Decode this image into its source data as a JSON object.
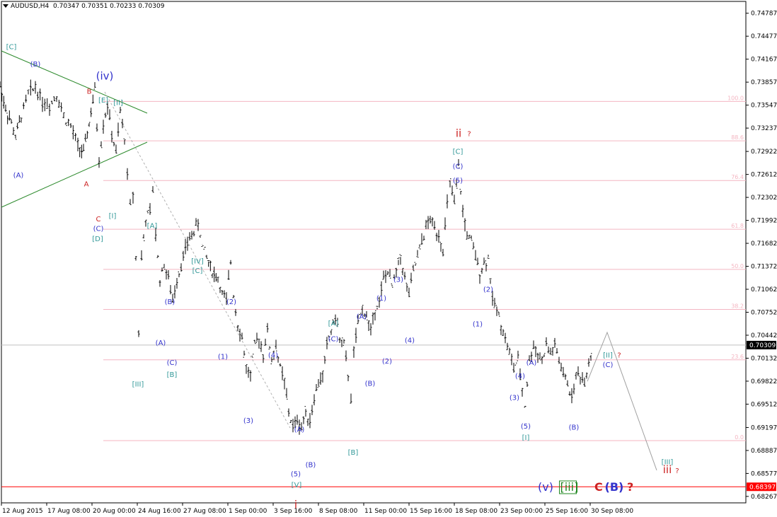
{
  "header": {
    "symbol_timeframe": "AUDUSD,H4",
    "ohlc": "0.70347 0.70351 0.70233 0.70309"
  },
  "colors": {
    "background": "#ffffff",
    "candle": "#000000",
    "fib_line": "#f4b6c2",
    "fib_label": "#f4b6c2",
    "trendline": "#2e8b2e",
    "support_line": "#ff0000",
    "price_line": "#c0c0c0",
    "label_blue": "#3333cc",
    "label_teal": "#339999",
    "label_red": "#cc2222",
    "label_green": "#228822",
    "projection": "#a0a0a0",
    "dashed": "#b0b0b0"
  },
  "chart_data": {
    "type": "candlestick",
    "title": "AUDUSD,H4",
    "y_axis": {
      "ylim": [
        0.6818,
        0.7487
      ],
      "ticks": [
        "0.74787",
        "0.74477",
        "0.74167",
        "0.73857",
        "0.73547",
        "0.73237",
        "0.72922",
        "0.72612",
        "0.72302",
        "0.71992",
        "0.71682",
        "0.71372",
        "0.71062",
        "0.70752",
        "0.70442",
        "0.70132",
        "0.69822",
        "0.69512",
        "0.69197",
        "0.68887",
        "0.68577",
        "0.68267"
      ],
      "current_price": "0.70309",
      "support_price": "0.68397"
    },
    "x_axis": {
      "tick_labels": [
        "12 Aug 2015",
        "17 Aug 08:00",
        "20 Aug 00:00",
        "24 Aug 16:00",
        "27 Aug 08:00",
        "1 Sep 00:00",
        "3 Sep 16:00",
        "8 Sep 08:00",
        "11 Sep 00:00",
        "15 Sep 16:00",
        "18 Sep 08:00",
        "23 Sep 00:00",
        "25 Sep 16:00",
        "30 Sep 08:00"
      ]
    },
    "fib_levels": [
      {
        "label": "100.0",
        "value": 0.73597
      },
      {
        "label": "88.6",
        "value": 0.73065
      },
      {
        "label": "76.4",
        "value": 0.7253
      },
      {
        "label": "61.8",
        "value": 0.71872
      },
      {
        "label": "50.0",
        "value": 0.7133
      },
      {
        "label": "38.2",
        "value": 0.7079
      },
      {
        "label": "23.6",
        "value": 0.7011
      },
      {
        "label": "0.0",
        "value": 0.6902
      }
    ],
    "price_path": [
      [
        0,
        0.738
      ],
      [
        8,
        0.735
      ],
      [
        16,
        0.733
      ],
      [
        22,
        0.7312
      ],
      [
        30,
        0.734
      ],
      [
        40,
        0.737
      ],
      [
        50,
        0.738
      ],
      [
        60,
        0.736
      ],
      [
        70,
        0.7355
      ],
      [
        80,
        0.737
      ],
      [
        90,
        0.734
      ],
      [
        100,
        0.7325
      ],
      [
        110,
        0.73
      ],
      [
        118,
        0.729
      ],
      [
        126,
        0.733
      ],
      [
        134,
        0.7375
      ],
      [
        140,
        0.728
      ],
      [
        146,
        0.733
      ],
      [
        152,
        0.7355
      ],
      [
        158,
        0.7315
      ],
      [
        164,
        0.729
      ],
      [
        170,
        0.7345
      ],
      [
        176,
        0.731
      ],
      [
        180,
        0.726
      ],
      [
        184,
        0.722
      ],
      [
        188,
        0.7235
      ],
      [
        192,
        0.715
      ],
      [
        196,
        0.705
      ],
      [
        200,
        0.715
      ],
      [
        206,
        0.72
      ],
      [
        212,
        0.721
      ],
      [
        216,
        0.724
      ],
      [
        220,
        0.718
      ],
      [
        226,
        0.712
      ],
      [
        232,
        0.714
      ],
      [
        238,
        0.712
      ],
      [
        244,
        0.709
      ],
      [
        250,
        0.712
      ],
      [
        256,
        0.714
      ],
      [
        262,
        0.716
      ],
      [
        268,
        0.7175
      ],
      [
        274,
        0.7185
      ],
      [
        280,
        0.7195
      ],
      [
        286,
        0.7165
      ],
      [
        292,
        0.715
      ],
      [
        300,
        0.713
      ],
      [
        308,
        0.712
      ],
      [
        314,
        0.71
      ],
      [
        320,
        0.709
      ],
      [
        326,
        0.7145
      ],
      [
        330,
        0.71
      ],
      [
        336,
        0.706
      ],
      [
        342,
        0.704
      ],
      [
        348,
        0.7
      ],
      [
        354,
        0.699
      ],
      [
        360,
        0.703
      ],
      [
        366,
        0.704
      ],
      [
        372,
        0.702
      ],
      [
        378,
        0.705
      ],
      [
        384,
        0.701
      ],
      [
        390,
        0.703
      ],
      [
        396,
        0.7
      ],
      [
        402,
        0.698
      ],
      [
        408,
        0.694
      ],
      [
        414,
        0.692
      ],
      [
        420,
        0.693
      ],
      [
        426,
        0.692
      ],
      [
        432,
        0.694
      ],
      [
        438,
        0.693
      ],
      [
        444,
        0.696
      ],
      [
        450,
        0.698
      ],
      [
        456,
        0.699
      ],
      [
        462,
        0.703
      ],
      [
        468,
        0.705
      ],
      [
        474,
        0.707
      ],
      [
        480,
        0.704
      ],
      [
        486,
        0.703
      ],
      [
        492,
        0.699
      ],
      [
        496,
        0.696
      ],
      [
        500,
        0.702
      ],
      [
        506,
        0.706
      ],
      [
        512,
        0.708
      ],
      [
        518,
        0.707
      ],
      [
        524,
        0.705
      ],
      [
        530,
        0.708
      ],
      [
        536,
        0.709
      ],
      [
        542,
        0.712
      ],
      [
        548,
        0.713
      ],
      [
        554,
        0.711
      ],
      [
        560,
        0.713
      ],
      [
        566,
        0.715
      ],
      [
        572,
        0.712
      ],
      [
        578,
        0.71
      ],
      [
        584,
        0.713
      ],
      [
        590,
        0.715
      ],
      [
        596,
        0.717
      ],
      [
        602,
        0.719
      ],
      [
        608,
        0.72
      ],
      [
        614,
        0.719
      ],
      [
        620,
        0.718
      ],
      [
        626,
        0.716
      ],
      [
        632,
        0.722
      ],
      [
        636,
        0.725
      ],
      [
        642,
        0.722
      ],
      [
        648,
        0.727
      ],
      [
        654,
        0.721
      ],
      [
        660,
        0.718
      ],
      [
        666,
        0.717
      ],
      [
        672,
        0.715
      ],
      [
        678,
        0.713
      ],
      [
        684,
        0.714
      ],
      [
        690,
        0.715
      ],
      [
        696,
        0.709
      ],
      [
        702,
        0.708
      ],
      [
        708,
        0.706
      ],
      [
        714,
        0.704
      ],
      [
        720,
        0.702
      ],
      [
        726,
        0.7
      ],
      [
        732,
        0.701
      ],
      [
        738,
        0.697
      ],
      [
        742,
        0.695
      ],
      [
        748,
        0.701
      ],
      [
        754,
        0.703
      ],
      [
        760,
        0.702
      ],
      [
        766,
        0.701
      ],
      [
        772,
        0.703
      ],
      [
        778,
        0.702
      ],
      [
        784,
        0.703
      ],
      [
        790,
        0.701
      ],
      [
        796,
        0.699
      ],
      [
        802,
        0.698
      ],
      [
        808,
        0.696
      ],
      [
        814,
        0.699
      ],
      [
        820,
        0.699
      ],
      [
        826,
        0.698
      ],
      [
        832,
        0.701
      ],
      [
        838,
        0.703
      ]
    ],
    "projection": [
      [
        830,
        0.6982
      ],
      [
        858,
        0.7048
      ],
      [
        928,
        0.6862
      ]
    ],
    "wave_labels": [
      {
        "text": "[C]",
        "x": 16,
        "v": 0.743,
        "color": "teal"
      },
      {
        "text": "(B)",
        "x": 50,
        "v": 0.7407,
        "color": "blue"
      },
      {
        "text": "(A)",
        "x": 26,
        "v": 0.7257,
        "color": "blue"
      },
      {
        "text": "B",
        "x": 126,
        "v": 0.737,
        "color": "red"
      },
      {
        "text": "(iv)",
        "x": 148,
        "v": 0.7389,
        "color": "blue",
        "big": true
      },
      {
        "text": "[E]",
        "x": 146,
        "v": 0.7358,
        "color": "teal"
      },
      {
        "text": "[II]",
        "x": 167,
        "v": 0.7355,
        "color": "teal"
      },
      {
        "text": "A",
        "x": 122,
        "v": 0.7245,
        "color": "red"
      },
      {
        "text": "[I]",
        "x": 159,
        "v": 0.7202,
        "color": "teal"
      },
      {
        "text": "C",
        "x": 139,
        "v": 0.7198,
        "color": "red"
      },
      {
        "text": "(C)",
        "x": 139,
        "v": 0.7185,
        "color": "blue"
      },
      {
        "text": "[D]",
        "x": 138,
        "v": 0.7171,
        "color": "teal"
      },
      {
        "text": "[A]",
        "x": 215,
        "v": 0.7189,
        "color": "teal"
      },
      {
        "text": "[IV]",
        "x": 279,
        "v": 0.7141,
        "color": "teal"
      },
      {
        "text": "[C]",
        "x": 279,
        "v": 0.7128,
        "color": "teal"
      },
      {
        "text": "(B)",
        "x": 240,
        "v": 0.7086,
        "color": "blue"
      },
      {
        "text": "(2)",
        "x": 327,
        "v": 0.7086,
        "color": "blue"
      },
      {
        "text": "(A)",
        "x": 227,
        "v": 0.7031,
        "color": "blue"
      },
      {
        "text": "(C)",
        "x": 243,
        "v": 0.7004,
        "color": "blue"
      },
      {
        "text": "[B]",
        "x": 243,
        "v": 0.6988,
        "color": "teal"
      },
      {
        "text": "(1)",
        "x": 315,
        "v": 0.7012,
        "color": "blue"
      },
      {
        "text": "(4)",
        "x": 386,
        "v": 0.7014,
        "color": "blue"
      },
      {
        "text": "[III]",
        "x": 195,
        "v": 0.6975,
        "color": "teal"
      },
      {
        "text": "(3)",
        "x": 351,
        "v": 0.6926,
        "color": "blue"
      },
      {
        "text": "(A)",
        "x": 423,
        "v": 0.6914,
        "color": "blue"
      },
      {
        "text": "(B)",
        "x": 439,
        "v": 0.6866,
        "color": "blue"
      },
      {
        "text": "(5)",
        "x": 418,
        "v": 0.6854,
        "color": "blue"
      },
      {
        "text": "[V]",
        "x": 419,
        "v": 0.6839,
        "color": "teal"
      },
      {
        "text": "i",
        "x": 418,
        "v": 0.6811,
        "color": "red",
        "big": true
      },
      {
        "text": "[A]",
        "x": 471,
        "v": 0.7057,
        "color": "teal"
      },
      {
        "text": "(A)",
        "x": 511,
        "v": 0.7066,
        "color": "blue"
      },
      {
        "text": "(C)",
        "x": 471,
        "v": 0.7036,
        "color": "blue"
      },
      {
        "text": "(1)",
        "x": 539,
        "v": 0.7091,
        "color": "blue"
      },
      {
        "text": "(3)",
        "x": 563,
        "v": 0.7116,
        "color": "blue"
      },
      {
        "text": "(4)",
        "x": 579,
        "v": 0.7034,
        "color": "blue"
      },
      {
        "text": "(2)",
        "x": 547,
        "v": 0.7006,
        "color": "blue"
      },
      {
        "text": "(B)",
        "x": 523,
        "v": 0.6976,
        "color": "blue"
      },
      {
        "text": "[B]",
        "x": 499,
        "v": 0.6883,
        "color": "teal"
      },
      {
        "text": "ii",
        "x": 648,
        "v": 0.7312,
        "color": "red",
        "big": true
      },
      {
        "text": "?",
        "x": 663,
        "v": 0.7313,
        "color": "red"
      },
      {
        "text": "[C]",
        "x": 647,
        "v": 0.7289,
        "color": "teal"
      },
      {
        "text": "(C)",
        "x": 647,
        "v": 0.7269,
        "color": "blue"
      },
      {
        "text": "(5)",
        "x": 647,
        "v": 0.725,
        "color": "blue"
      },
      {
        "text": "(2)",
        "x": 690,
        "v": 0.7103,
        "color": "blue"
      },
      {
        "text": "(1)",
        "x": 675,
        "v": 0.7056,
        "color": "blue"
      },
      {
        "text": "(A)",
        "x": 751,
        "v": 0.7004,
        "color": "blue"
      },
      {
        "text": "(4)",
        "x": 735,
        "v": 0.6986,
        "color": "blue"
      },
      {
        "text": "(3)",
        "x": 727,
        "v": 0.6957,
        "color": "blue"
      },
      {
        "text": "(5)",
        "x": 743,
        "v": 0.6918,
        "color": "blue"
      },
      {
        "text": "[I]",
        "x": 743,
        "v": 0.6903,
        "color": "teal"
      },
      {
        "text": "(B)",
        "x": 811,
        "v": 0.6917,
        "color": "blue"
      },
      {
        "text": "[II]",
        "x": 859,
        "v": 0.7014,
        "color": "teal"
      },
      {
        "text": "?",
        "x": 875,
        "v": 0.7014,
        "color": "red"
      },
      {
        "text": "(C)",
        "x": 859,
        "v": 0.7001,
        "color": "blue"
      },
      {
        "text": "[III]",
        "x": 943,
        "v": 0.687,
        "color": "teal"
      },
      {
        "text": "iii",
        "x": 943,
        "v": 0.6858,
        "color": "red",
        "big": true
      },
      {
        "text": "?",
        "x": 957,
        "v": 0.6858,
        "color": "red"
      }
    ],
    "legend": [
      {
        "text": "(v)",
        "color": "blue"
      },
      {
        "text": "[iii]",
        "color": "green",
        "boxed": true
      },
      {
        "text": "C",
        "color": "red",
        "bold": true
      },
      {
        "text": "(B)",
        "color": "blue",
        "bold": true
      },
      {
        "text": "?",
        "color": "red",
        "bold": true
      }
    ]
  }
}
